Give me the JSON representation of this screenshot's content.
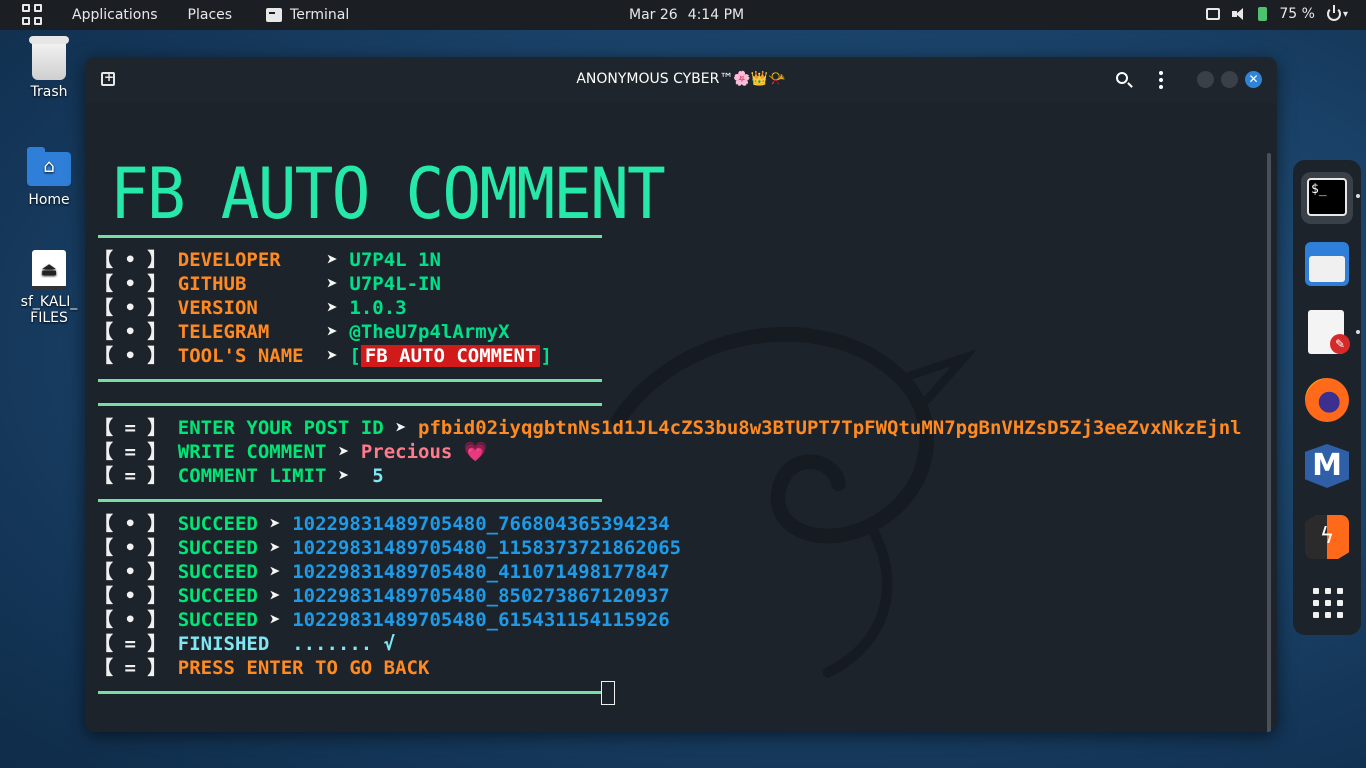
{
  "topbar": {
    "applications": "Applications",
    "places": "Places",
    "terminal": "Terminal",
    "date": "Mar 26",
    "time": "4:14 PM",
    "battery": "75 %"
  },
  "desktop": {
    "trash": "Trash",
    "home": "Home",
    "drive_line1": "sf_KALI_",
    "drive_line2": "FILES"
  },
  "window": {
    "title": "ANONYMOUS CYBER™🌸👑📯"
  },
  "terminal": {
    "banner": "FB AUTO COMMENT",
    "info": [
      {
        "bracket": "【 • 】",
        "key": "DEVELOPER   ",
        "arrow": " ➤ ",
        "value": "U7P4L 1N"
      },
      {
        "bracket": "【 • 】",
        "key": "GITHUB      ",
        "arrow": " ➤ ",
        "value": "U7P4L-IN"
      },
      {
        "bracket": "【 • 】",
        "key": "VERSION     ",
        "arrow": " ➤ ",
        "value": "1.0.3"
      },
      {
        "bracket": "【 • 】",
        "key": "TELEGRAM    ",
        "arrow": " ➤ ",
        "value": "@TheU7p4lArmyX"
      },
      {
        "bracket": "【 • 】",
        "key": "TOOL'S NAME ",
        "arrow": " ➤ ",
        "value": "FB AUTO COMMENT"
      }
    ],
    "inputs": [
      {
        "bracket": "【 = 】",
        "key": "ENTER YOUR POST ID",
        "arrow": " ➤ ",
        "value": "pfbid02iyqgbtnNs1d1JL4cZS3bu8w3BTUPT7TpFWQtuMN7pgBnVHZsD5Zj3eeZvxNkzEjnl"
      },
      {
        "bracket": "【 = 】",
        "key": "WRITE COMMENT",
        "arrow": " ➤ ",
        "value": "Precious 💗"
      },
      {
        "bracket": "【 = 】",
        "key": "COMMENT LIMIT",
        "arrow": " ➤  ",
        "value": "5"
      }
    ],
    "results": [
      {
        "bracket": "【 • 】",
        "key": "SUCCEED",
        "arrow": " ➤ ",
        "value": "10229831489705480_766804365394234"
      },
      {
        "bracket": "【 • 】",
        "key": "SUCCEED",
        "arrow": " ➤ ",
        "value": "10229831489705480_1158373721862065"
      },
      {
        "bracket": "【 • 】",
        "key": "SUCCEED",
        "arrow": " ➤ ",
        "value": "10229831489705480_411071498177847"
      },
      {
        "bracket": "【 • 】",
        "key": "SUCCEED",
        "arrow": " ➤ ",
        "value": "10229831489705480_850273867120937"
      },
      {
        "bracket": "【 • 】",
        "key": "SUCCEED",
        "arrow": " ➤ ",
        "value": "10229831489705480_615431154115926"
      }
    ],
    "finished": {
      "bracket": "【 = 】",
      "text": "FINISHED  ....... √"
    },
    "press": {
      "bracket": "【 = 】",
      "text": "PRESS ENTER TO GO BACK"
    }
  },
  "dock": {
    "terminal_prompt": "$_"
  }
}
